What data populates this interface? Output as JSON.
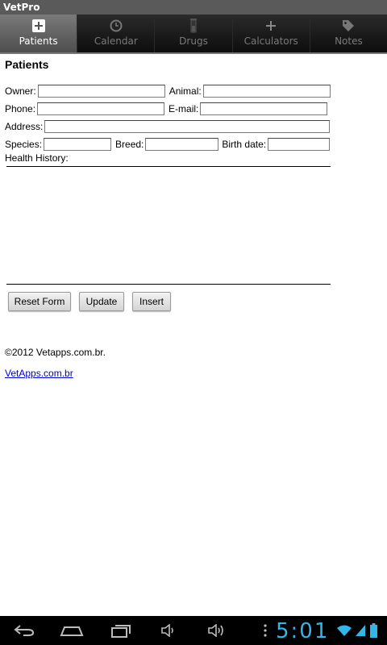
{
  "app": {
    "title": "VetPro"
  },
  "tabs": [
    {
      "label": "Patients",
      "icon": "plus-square-icon",
      "active": true
    },
    {
      "label": "Calendar",
      "icon": "clock-icon",
      "active": false
    },
    {
      "label": "Drugs",
      "icon": "vial-icon",
      "active": false
    },
    {
      "label": "Calculators",
      "icon": "plus-icon",
      "active": false
    },
    {
      "label": "Notes",
      "icon": "tag-icon",
      "active": false
    }
  ],
  "form": {
    "heading": "Patients",
    "owner_label": "Owner:",
    "owner_value": "",
    "animal_label": "Animal:",
    "animal_value": "",
    "phone_label": "Phone:",
    "phone_value": "",
    "email_label": "E-mail:",
    "email_value": "",
    "address_label": "Address:",
    "address_value": "",
    "species_label": "Species:",
    "species_value": "",
    "breed_label": "Breed:",
    "breed_value": "",
    "birth_label": "Birth date:",
    "birth_value": "",
    "history_label": "Health History:"
  },
  "buttons": {
    "reset": "Reset Form",
    "update": "Update",
    "insert": "Insert"
  },
  "footer": {
    "copyright": "©2012 Vetapps.com.br.",
    "link": "VetApps.com.br"
  },
  "status": {
    "time": "5:01"
  },
  "colors": {
    "accent": "#33b5e5",
    "link": "#0000cc"
  }
}
